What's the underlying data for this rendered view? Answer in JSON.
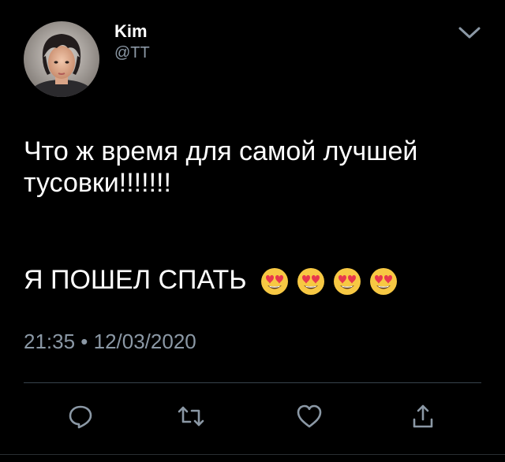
{
  "user": {
    "name": "Kim",
    "handle": "@TT",
    "avatar": "avatar-photo"
  },
  "header": {
    "menu_icon": "chevron-down-icon"
  },
  "tweet": {
    "line1": "Что ж время для самой лучшей тусовки!!!!!!!",
    "line2": "Я ПОШЕЛ СПАТЬ",
    "emoji": [
      "heart-eyes-emoji",
      "heart-eyes-emoji",
      "heart-eyes-emoji",
      "heart-eyes-emoji"
    ],
    "timestamp": "21:35 • 12/03/2020"
  },
  "actions": [
    {
      "icon": "reply-icon"
    },
    {
      "icon": "retweet-icon"
    },
    {
      "icon": "like-icon"
    },
    {
      "icon": "share-icon"
    }
  ],
  "colors": {
    "background": "#000000",
    "text": "#ffffff",
    "muted": "#8b98a5",
    "divider": "#38444d"
  }
}
